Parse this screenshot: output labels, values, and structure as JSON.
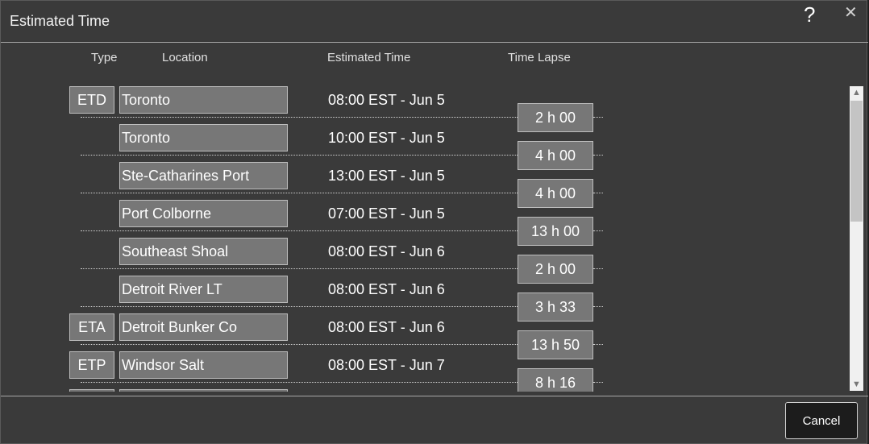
{
  "dialog": {
    "title": "Estimated Time",
    "help_label": "?",
    "close_label": "✕"
  },
  "columns": {
    "type": "Type",
    "location": "Location",
    "estimated_time": "Estimated Time",
    "time_lapse": "Time Lapse"
  },
  "rows": [
    {
      "type": "ETD",
      "location": "Toronto",
      "time": "08:00 EST - Jun 5"
    },
    {
      "type": "",
      "location": "Toronto",
      "time": "10:00 EST - Jun 5"
    },
    {
      "type": "",
      "location": "Ste-Catharines Port",
      "time": "13:00 EST - Jun 5"
    },
    {
      "type": "",
      "location": "Port Colborne",
      "time": "07:00 EST - Jun 5"
    },
    {
      "type": "",
      "location": "Southeast Shoal",
      "time": "08:00 EST - Jun 6"
    },
    {
      "type": "",
      "location": "Detroit River LT",
      "time": "08:00 EST - Jun 6"
    },
    {
      "type": "ETA",
      "location": "Detroit Bunker Co",
      "time": "08:00 EST - Jun 6"
    },
    {
      "type": "ETP",
      "location": "Windsor Salt",
      "time": "08:00 EST - Jun 7"
    },
    {
      "type": "",
      "location": "",
      "time": ""
    }
  ],
  "lapses": [
    "2 h 00",
    "4 h 00",
    "4 h 00",
    "13 h 00",
    "2 h 00",
    "3 h 33",
    "13 h 50",
    "8 h 16"
  ],
  "scrollbar": {
    "up_icon": "▲",
    "down_icon": "▼"
  },
  "footer": {
    "cancel_label": "Cancel"
  }
}
